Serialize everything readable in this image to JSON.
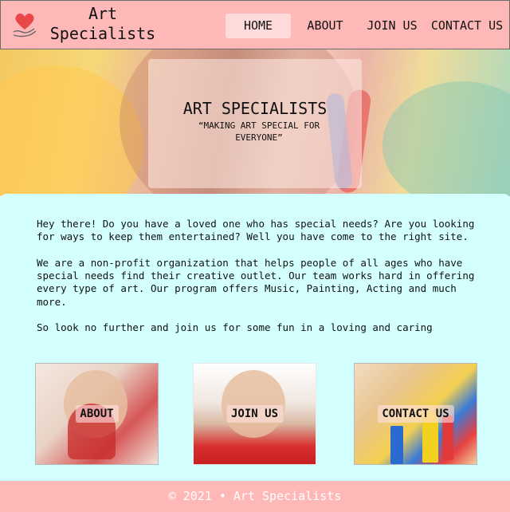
{
  "header": {
    "brand_line1": "Art",
    "brand_line2": "Specialists",
    "nav": {
      "home": "HOME",
      "about": "ABOUT",
      "join": "JOIN US",
      "contact": "CONTACT US"
    }
  },
  "hero": {
    "title": "ART SPECIALISTS",
    "subtitle": "“MAKING ART SPECIAL FOR EVERYONE”"
  },
  "main": {
    "paragraph1": "Hey there! Do you have a loved one who has special needs? Are you looking\nfor ways to keep them entertained? Well you have come to the right site.",
    "paragraph2": "We are a non-profit organization that helps people of all ages who have\nspecial needs find their creative outlet. Our team works hard in offering\nevery type of art. Our program offers  Music, Painting, Acting and much\nmore.",
    "paragraph3": "So look no further and join us for some fun in a loving and caring"
  },
  "cards": {
    "about": "ABOUT",
    "join": "JOIN US",
    "contact": "CONTACT US"
  },
  "footer": {
    "text": "© 2021 • Art Specialists"
  },
  "colors": {
    "header_bg": "#ffb8b8",
    "main_bg": "#d4ffff",
    "footer_bg": "#ffb8b8",
    "heart": "#e84848"
  }
}
